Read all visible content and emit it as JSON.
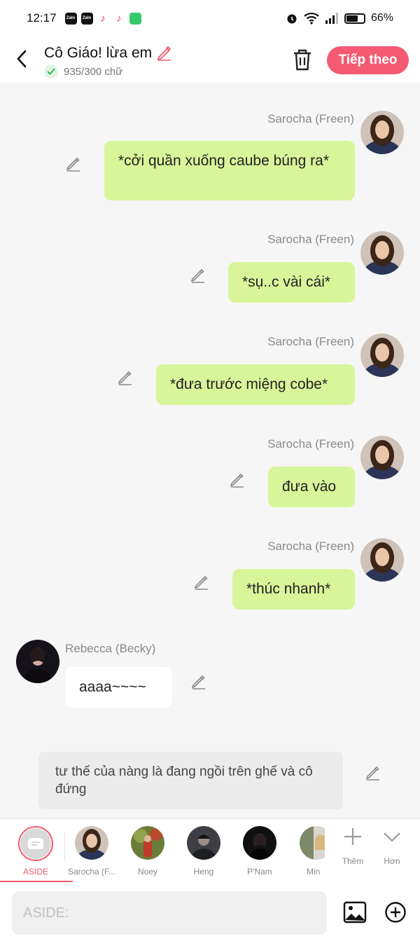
{
  "status": {
    "time": "12:17",
    "apps": [
      "Zalo",
      "Zalo",
      "tiktok",
      "tiktok",
      "messages"
    ],
    "battery": "66%",
    "battery_level": 0.66
  },
  "header": {
    "title": "Cô Giáo! lừa em",
    "word_count": "935/300 chữ",
    "next_label": "Tiếp theo"
  },
  "messages": [
    {
      "sender": "Sarocha (Freen)",
      "side": "right",
      "text": "*cởi quần xuống caube búng ra*"
    },
    {
      "sender": "Sarocha (Freen)",
      "side": "right",
      "text": "*sụ..c vài cái*"
    },
    {
      "sender": "Sarocha (Freen)",
      "side": "right",
      "text": "*đưa trước miệng cobe*"
    },
    {
      "sender": "Sarocha (Freen)",
      "side": "right",
      "text": "đưa vào"
    },
    {
      "sender": "Sarocha (Freen)",
      "side": "right",
      "text": "*thúc nhanh*"
    },
    {
      "sender": "Rebecca (Becky)",
      "side": "left",
      "text": "aaaa~~~~"
    }
  ],
  "aside_text": "tư thế của nàng là đang ngồi trên ghế và cô đứng",
  "characters": {
    "aside": "ASIDE",
    "list": [
      "Sarocha (F...",
      "Noey",
      "Heng",
      "P'Nam",
      "Min"
    ],
    "more_label": "Thêm",
    "expand_label": "Hơn"
  },
  "input": {
    "placeholder": "ASIDE:"
  },
  "colors": {
    "accent": "#f45a72",
    "bubble_green": "#d8f59a",
    "aside_red": "#f05a6b"
  }
}
